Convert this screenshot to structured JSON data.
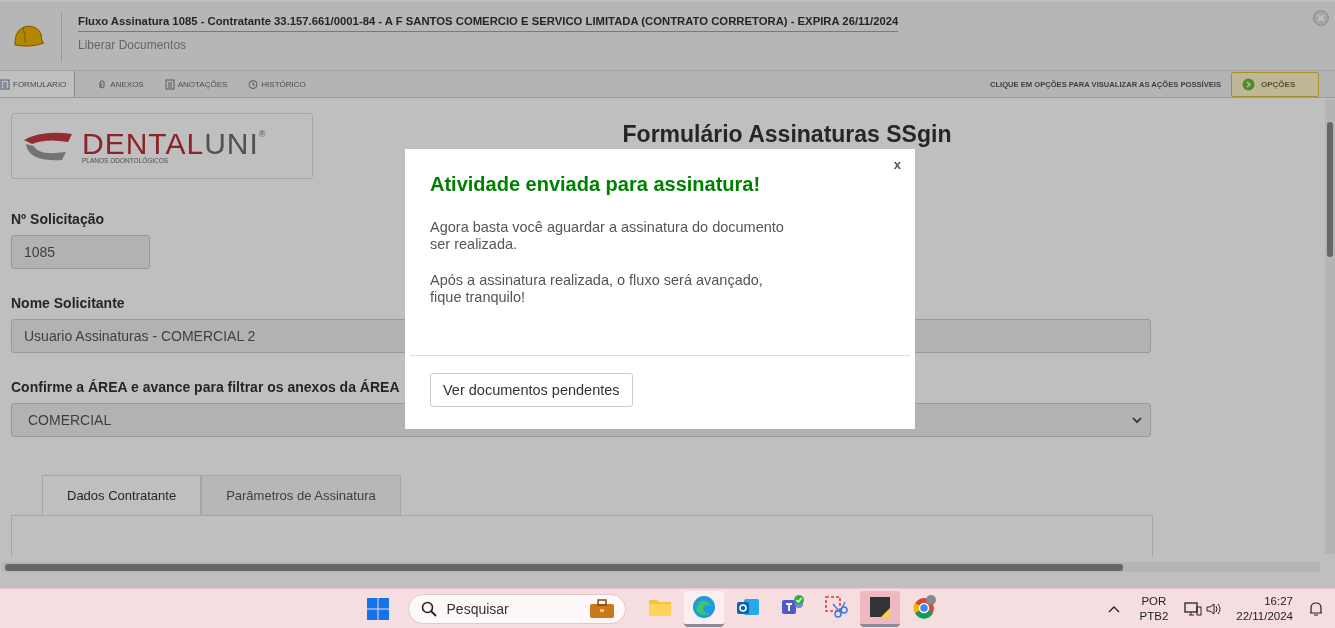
{
  "header": {
    "title": "Fluxo Assinatura 1085 - Contratante 33.157.661/0001-84 - A F SANTOS COMERCIO E SERVICO LIMITADA (CONTRATO CORRETORA) - EXPIRA 26/11/2024",
    "subtitle": "Liberar Documentos"
  },
  "toolbar": {
    "tabs": [
      {
        "label": "FORMULARIO",
        "kind": "form",
        "selected": true
      },
      {
        "label": "ANEXOS",
        "kind": "clip",
        "selected": false
      },
      {
        "label": "ANOTAÇÕES",
        "kind": "notes",
        "selected": false
      },
      {
        "label": "HISTÓRICO",
        "kind": "clock",
        "selected": false
      }
    ],
    "hint": "CLIQUE EM OPÇÕES PARA VISUALIZAR AS AÇÕES POSSÍVEIS",
    "options_button": "OPÇÕES"
  },
  "form": {
    "logo": {
      "brand_part1": "DENTAL",
      "brand_part2": "UNI",
      "mark": "®",
      "tagline": "PLANOS ODONTOLÓGICOS"
    },
    "title": "Formulário Assinaturas SSgin",
    "fields": [
      {
        "label": "Nº Solicitação",
        "value": "1085",
        "kind": "short"
      },
      {
        "label": "Nome Solicitante",
        "value": "Usuario Assinaturas - COMERCIAL 2",
        "kind": "text"
      },
      {
        "label": "Confirme a ÁREA e avance para filtrar os anexos da ÁREA",
        "value": "COMERCIAL",
        "kind": "select"
      }
    ],
    "tabs": [
      {
        "label": "Dados Contratante",
        "selected": true
      },
      {
        "label": "Parâmetros de Assinatura",
        "selected": false
      }
    ]
  },
  "dialog": {
    "close": "x",
    "title": "Atividade enviada para assinatura!",
    "paragraphs": [
      "Agora basta você aguardar a assinatura do documento ser realizada.",
      "Após a assinatura realizada, o fluxo será avançado, fique tranquilo!"
    ],
    "button": "Ver documentos pendentes"
  },
  "taskbar": {
    "search_placeholder": "Pesquisar",
    "apps": [
      {
        "kind": "folder",
        "active": false
      },
      {
        "kind": "edge",
        "active": true
      },
      {
        "kind": "outlook",
        "active": false
      },
      {
        "kind": "teams",
        "active": false
      },
      {
        "kind": "snip",
        "active": false
      },
      {
        "kind": "sticky",
        "active": true
      },
      {
        "kind": "chrome",
        "active": false
      }
    ],
    "language": "POR",
    "layout": "PTB2",
    "time": "16:27",
    "date": "22/11/2024"
  }
}
